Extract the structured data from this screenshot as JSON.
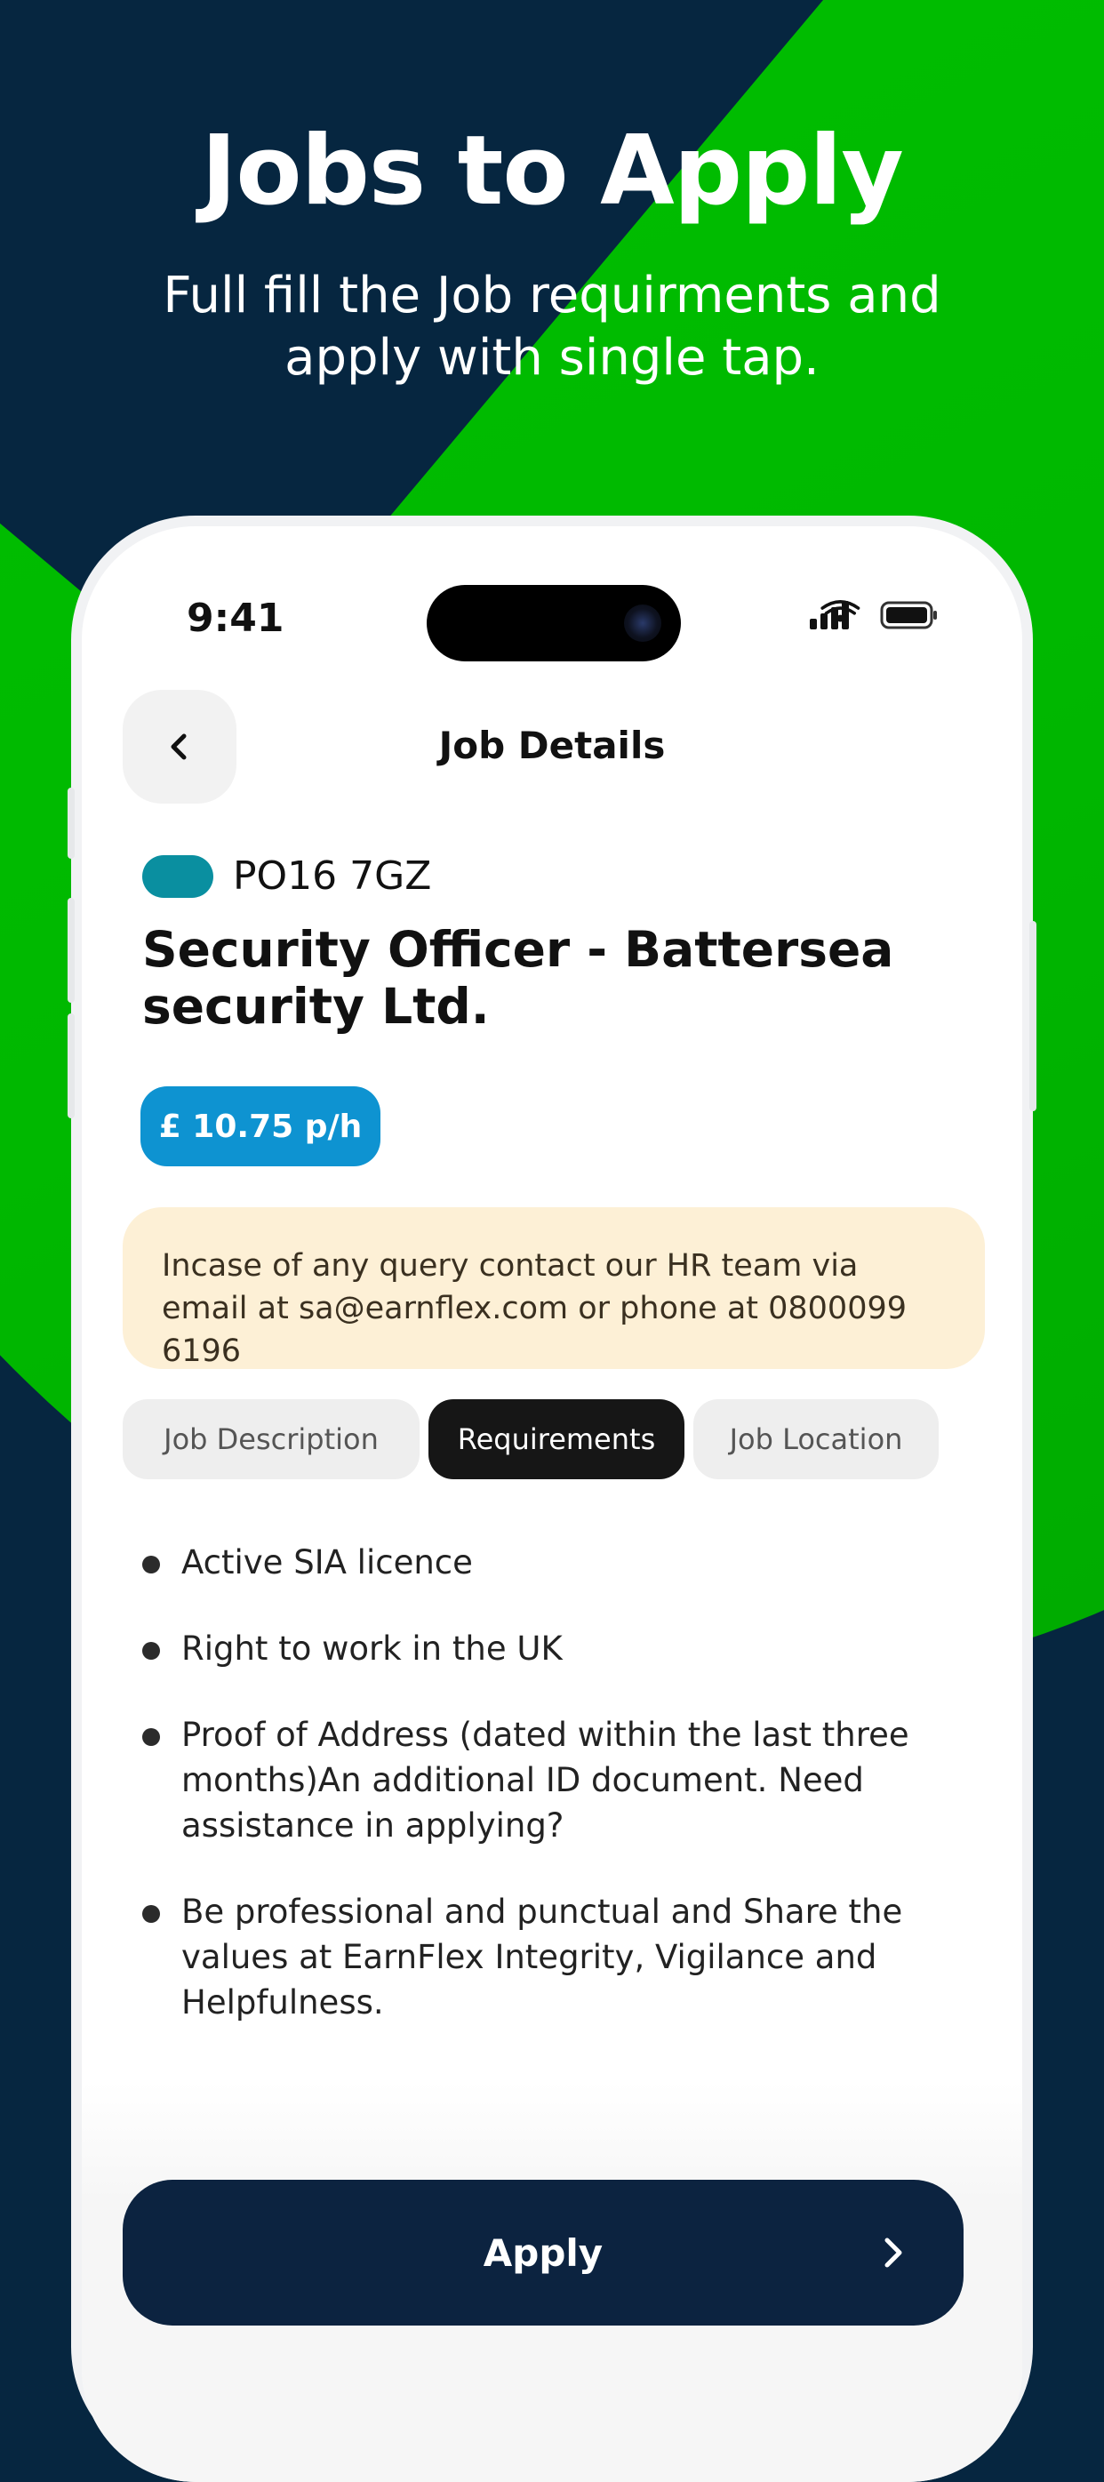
{
  "promo": {
    "headline": "Jobs to Apply",
    "subline": "Full fill the Job requirments and apply with single tap."
  },
  "status_bar": {
    "time": "9:41"
  },
  "header": {
    "title": "Job Details"
  },
  "job": {
    "postcode": "PO16 7GZ",
    "title": "Security Officer - Battersea security Ltd.",
    "rate": "£ 10.75 p/h"
  },
  "notice": "Incase of any query contact our HR team via email at sa@earnflex.com or phone at 0800099 6196",
  "tabs": [
    {
      "label": "Job Description",
      "active": false
    },
    {
      "label": "Requirements",
      "active": true
    },
    {
      "label": "Job Location",
      "active": false
    }
  ],
  "requirements": [
    "Active SIA licence",
    "Right to work in the UK",
    "Proof of Address (dated within the last three months)An additional ID document. Need assistance in applying?",
    "Be professional and punctual and Share the values at EarnFlex Integrity, Vigilance and Helpfulness."
  ],
  "apply_button": {
    "label": "Apply"
  },
  "colors": {
    "navy_background": "#062640",
    "green_background": "#00c000",
    "postcode_pill": "#0a8fa0",
    "rate_badge": "#0e93d1",
    "notice_background": "#fdf0d6",
    "active_tab": "#161616",
    "apply_button": "#0c2340"
  },
  "icons": [
    "back-chevron-icon",
    "signal-icon",
    "wifi-icon",
    "battery-icon",
    "chevron-right-icon"
  ]
}
